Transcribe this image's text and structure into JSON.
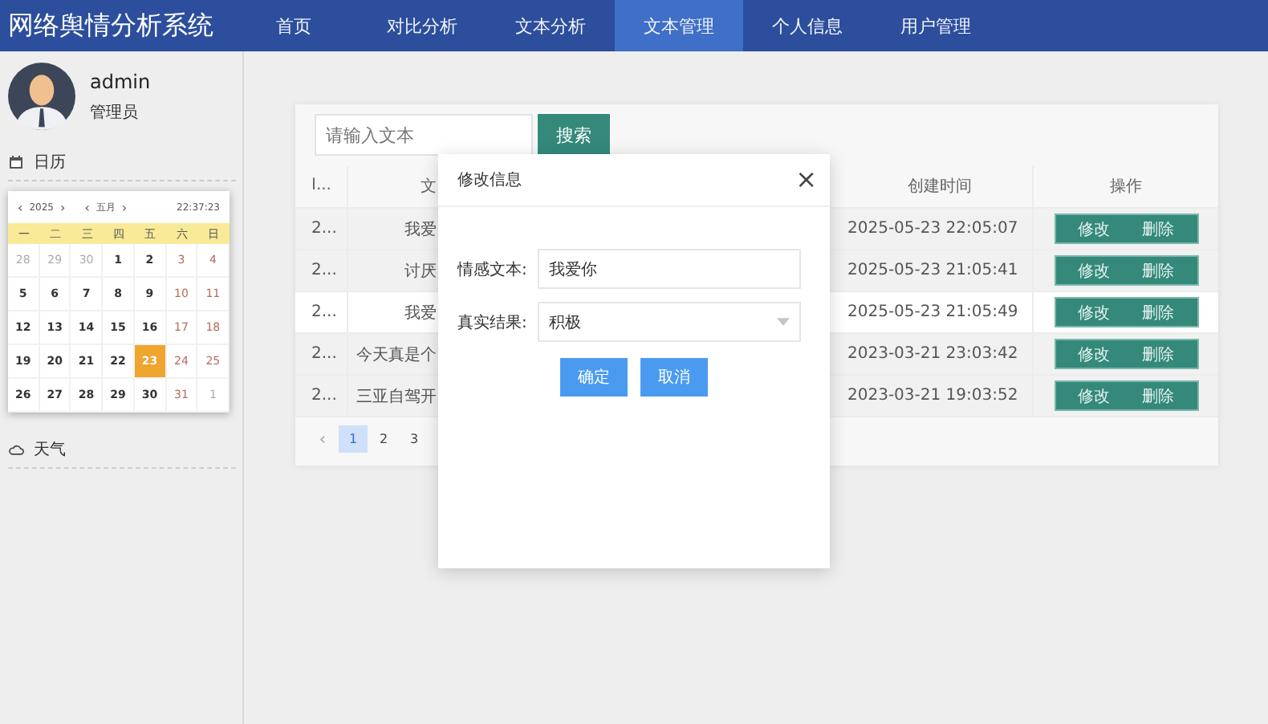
{
  "app_title": "网络舆情分析系统",
  "nav": [
    {
      "label": "首页",
      "selected": false
    },
    {
      "label": "对比分析",
      "selected": false
    },
    {
      "label": "文本分析",
      "selected": false
    },
    {
      "label": "文本管理",
      "selected": true
    },
    {
      "label": "个人信息",
      "selected": false
    },
    {
      "label": "用户管理",
      "selected": false
    }
  ],
  "user": {
    "name": "admin",
    "role": "管理员"
  },
  "sidebar": {
    "calendar_title": "日历",
    "weather_title": "天气"
  },
  "calendar": {
    "year": "2025",
    "month": "五月",
    "time": "22:37:23",
    "prev": "‹",
    "next": "›",
    "weekdays": [
      "一",
      "二",
      "三",
      "四",
      "五",
      "六",
      "日"
    ],
    "days": [
      {
        "label": "28",
        "kind": "other",
        "selected": false
      },
      {
        "label": "29",
        "kind": "other",
        "selected": false
      },
      {
        "label": "30",
        "kind": "other",
        "selected": false
      },
      {
        "label": "1",
        "kind": "day",
        "selected": false
      },
      {
        "label": "2",
        "kind": "day",
        "selected": false
      },
      {
        "label": "3",
        "kind": "weekend",
        "selected": false
      },
      {
        "label": "4",
        "kind": "weekend",
        "selected": false
      },
      {
        "label": "5",
        "kind": "day",
        "selected": false
      },
      {
        "label": "6",
        "kind": "day",
        "selected": false
      },
      {
        "label": "7",
        "kind": "day",
        "selected": false
      },
      {
        "label": "8",
        "kind": "day",
        "selected": false
      },
      {
        "label": "9",
        "kind": "day",
        "selected": false
      },
      {
        "label": "10",
        "kind": "weekend",
        "selected": false
      },
      {
        "label": "11",
        "kind": "weekend",
        "selected": false
      },
      {
        "label": "12",
        "kind": "day",
        "selected": false
      },
      {
        "label": "13",
        "kind": "day",
        "selected": false
      },
      {
        "label": "14",
        "kind": "day",
        "selected": false
      },
      {
        "label": "15",
        "kind": "day",
        "selected": false
      },
      {
        "label": "16",
        "kind": "day",
        "selected": false
      },
      {
        "label": "17",
        "kind": "weekend",
        "selected": false
      },
      {
        "label": "18",
        "kind": "weekend",
        "selected": false
      },
      {
        "label": "19",
        "kind": "day",
        "selected": false
      },
      {
        "label": "20",
        "kind": "day",
        "selected": false
      },
      {
        "label": "21",
        "kind": "day",
        "selected": false
      },
      {
        "label": "22",
        "kind": "day",
        "selected": false
      },
      {
        "label": "23",
        "kind": "day",
        "selected": true
      },
      {
        "label": "24",
        "kind": "weekend",
        "selected": false
      },
      {
        "label": "25",
        "kind": "weekend",
        "selected": false
      },
      {
        "label": "26",
        "kind": "day",
        "selected": false
      },
      {
        "label": "27",
        "kind": "day",
        "selected": false
      },
      {
        "label": "28",
        "kind": "day",
        "selected": false
      },
      {
        "label": "29",
        "kind": "day",
        "selected": false
      },
      {
        "label": "30",
        "kind": "day",
        "selected": false
      },
      {
        "label": "31",
        "kind": "weekend",
        "selected": false
      },
      {
        "label": "1",
        "kind": "other",
        "selected": false
      }
    ]
  },
  "search": {
    "placeholder": "请输入文本",
    "button": "搜索"
  },
  "table": {
    "columns": {
      "id": "I...",
      "text": "文",
      "created": "创建时间",
      "actions": "操作"
    },
    "rows": [
      {
        "id": "2...",
        "text": "我爱",
        "created": "2025-05-23 22:05:07",
        "edit": "修改",
        "delete": "删除",
        "selected": false
      },
      {
        "id": "2...",
        "text": "讨厌",
        "created": "2025-05-23 21:05:41",
        "edit": "修改",
        "delete": "删除",
        "selected": false
      },
      {
        "id": "2...",
        "text": "我爱",
        "created": "2025-05-23 21:05:49",
        "edit": "修改",
        "delete": "删除",
        "selected": true
      },
      {
        "id": "2...",
        "text": "今天真是个",
        "created": "2023-03-21 23:03:42",
        "edit": "修改",
        "delete": "删除",
        "selected": false
      },
      {
        "id": "2...",
        "text": "三亚自驾开",
        "created": "2023-03-21 19:03:52",
        "edit": "修改",
        "delete": "删除",
        "selected": false
      }
    ]
  },
  "pagination": {
    "prev": "‹",
    "pages": [
      {
        "label": "1",
        "selected": true
      },
      {
        "label": "2",
        "selected": false
      },
      {
        "label": "3",
        "selected": false
      }
    ]
  },
  "dialog": {
    "title": "修改信息",
    "close": "×",
    "fields": [
      {
        "kind": "input",
        "label": "情感文本:",
        "value": "我爱你"
      },
      {
        "kind": "select",
        "label": "真实结果:",
        "value": "积极"
      }
    ],
    "buttons": [
      "确定",
      "取消"
    ]
  }
}
